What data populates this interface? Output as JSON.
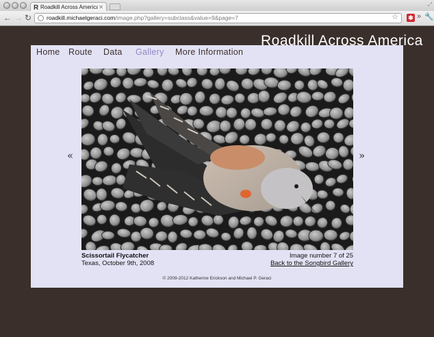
{
  "browser": {
    "tab_title": "Roadkill Across America - C",
    "tab_favicon": "R",
    "url_host": "roadkill.michaelgeraci.com",
    "url_path": "/image.php?gallery=subclass&value=9&page=7",
    "icons": {
      "back": "back-arrow-icon",
      "forward": "forward-arrow-icon",
      "reload": "reload-icon",
      "globe": "globe-icon",
      "star": "bookmark-star-icon",
      "extension": "extension-icon",
      "overflow": "chevron-overflow-icon",
      "wrench": "wrench-icon"
    }
  },
  "site": {
    "title": "Roadkill Across America",
    "nav": [
      {
        "label": "Home",
        "active": false
      },
      {
        "label": "Route",
        "active": false
      },
      {
        "label": "Data",
        "active": false
      },
      {
        "label": "Gallery",
        "active": true
      },
      {
        "label": "More Information",
        "active": false
      }
    ]
  },
  "image": {
    "prev_label": "«",
    "next_label": "»",
    "species": "Scissortail Flycatcher",
    "location_date": "Texas, October 9th, 2008",
    "counter": "Image number 7 of 25",
    "back_link": "Back to the Songbird Gallery"
  },
  "footer": {
    "copyright": "© 2009-2012 Katherine Erickson and Michael P. Geraci"
  },
  "colors": {
    "page_background": "#3a2f2b",
    "panel_background": "#e3e2f5",
    "nav_active": "#8e8ac4",
    "nav_text": "#3c2f2a"
  }
}
